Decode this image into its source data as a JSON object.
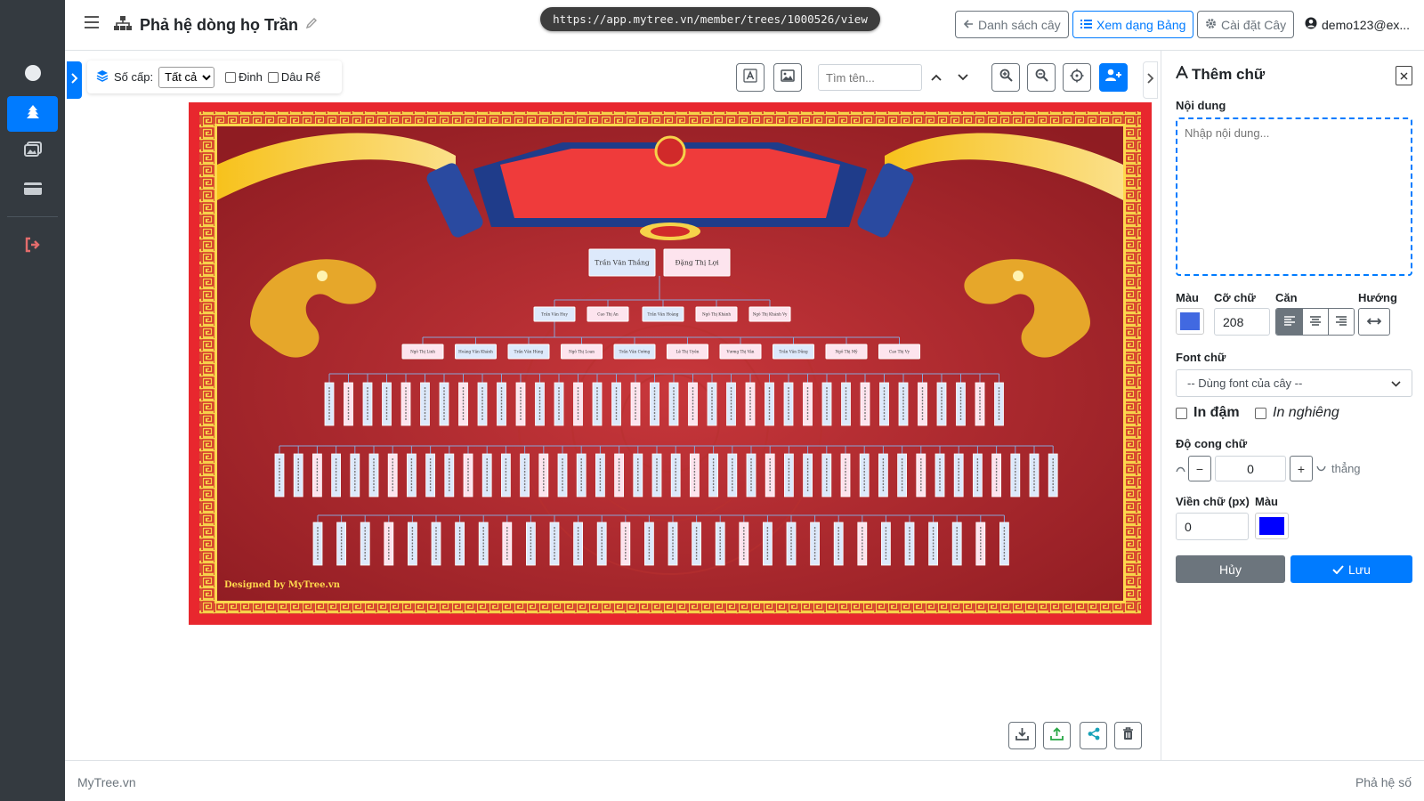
{
  "header": {
    "title": "Phả hệ dòng họ Trần",
    "url": "https://app.mytree.vn/member/trees/1000526/view",
    "btn_list": "Danh sách cây",
    "btn_table": "Xem dạng Bảng",
    "btn_settings": "Cài đặt Cây",
    "user": "demo123@ex..."
  },
  "toolbar": {
    "level_label": "Số cấp:",
    "level_value": "Tất cả",
    "chk_pin": "Đinh",
    "chk_inlaw": "Dâu Rể",
    "search_placeholder": "Tìm tên..."
  },
  "tree": {
    "root": [
      "Trần Văn Thắng",
      "Đặng Thị Lợi"
    ],
    "gen2": [
      "Trần Văn Huy",
      "Cao Thị An",
      "Trần Văn Hoàng",
      "Ngô Thị Khánh",
      "Ngô Thị Khánh Vy"
    ],
    "gen3": [
      "Ngô Thị Linh",
      "Hoàng Văn Khánh",
      "Trần Văn Hùng",
      "Ngô Thị Loan",
      "Trần Văn Cường",
      "Lê Thị Uyên",
      "Vương Thị Vân",
      "Trần Văn Dũng",
      "Ngô Thị Mỹ",
      "Cao Thị Vy"
    ],
    "credit": "Designed by MyTree.vn"
  },
  "panel": {
    "title": "Thêm chữ",
    "content_label": "Nội dung",
    "content_placeholder": "Nhập nội dung...",
    "color_label": "Màu",
    "size_label": "Cỡ chữ",
    "size_value": "208",
    "align_label": "Căn",
    "direction_label": "Hướng",
    "font_label": "Font chữ",
    "font_value": "-- Dùng font của cây --",
    "bold_label": "In đậm",
    "italic_label": "In nghiêng",
    "curve_label": "Độ cong chữ",
    "curve_value": "0",
    "curve_hint": "thẳng",
    "stroke_label": "Viền chữ (px)",
    "stroke_value": "0",
    "stroke_color_label": "Màu",
    "cancel": "Hủy",
    "save": "Lưu",
    "text_color": "#4169e1",
    "stroke_color": "#0000ff"
  },
  "footer": {
    "left": "MyTree.vn",
    "right": "Phả hệ số"
  }
}
